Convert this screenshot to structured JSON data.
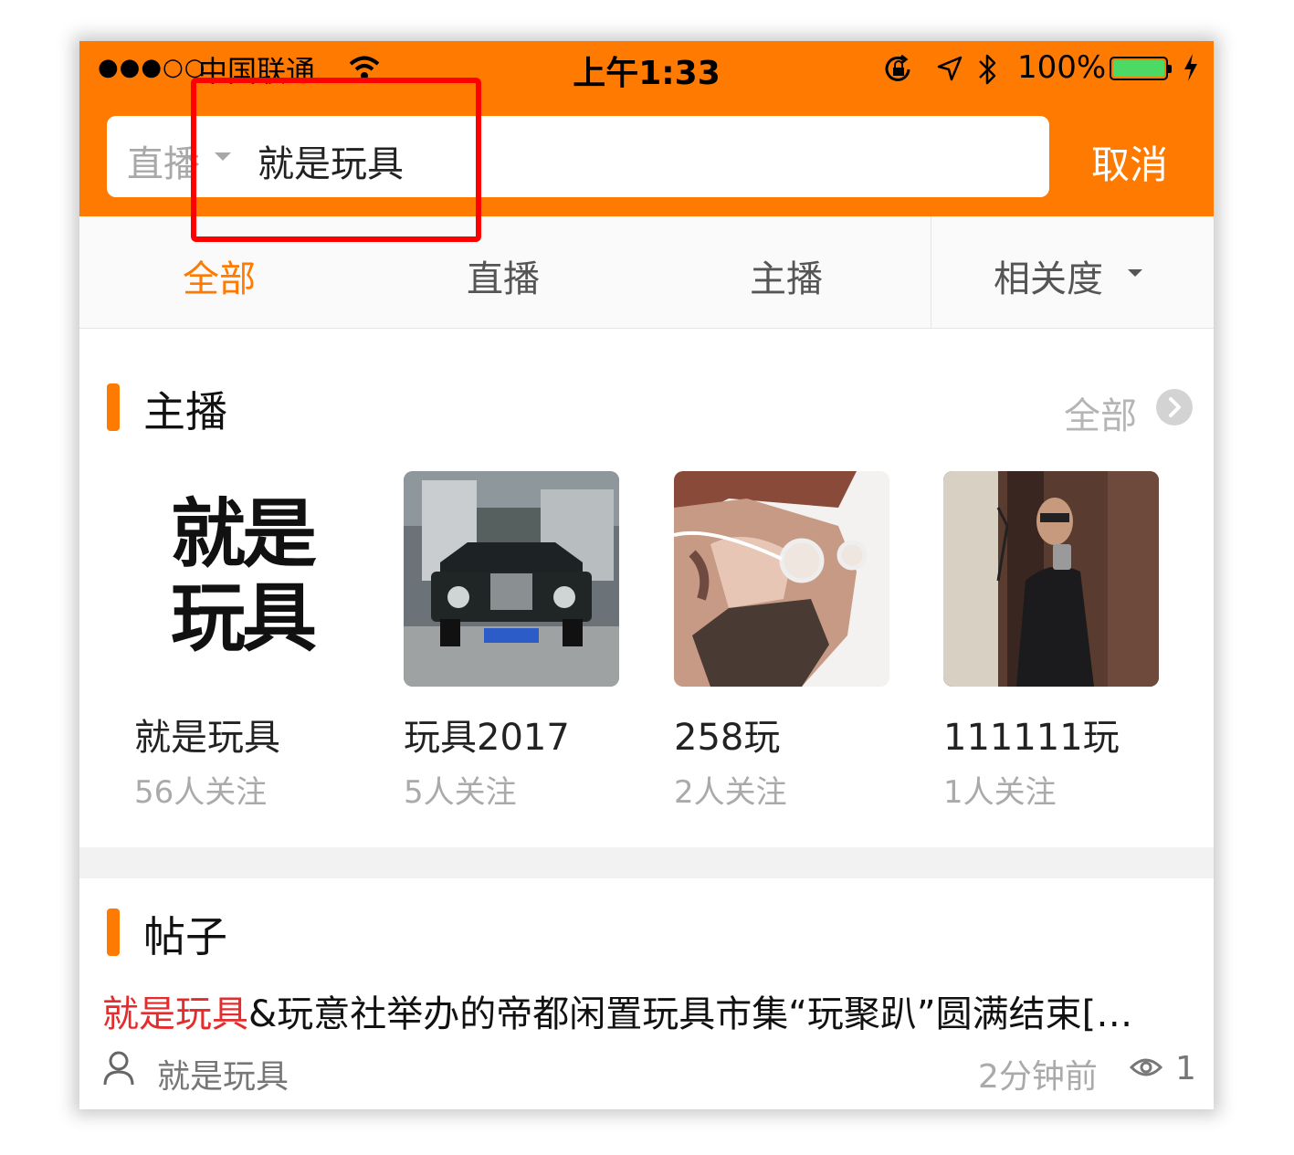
{
  "colors": {
    "accent": "#ff7a00",
    "highlight_red": "#ff0000",
    "keyword_red": "#e52b2b",
    "battery_green": "#4cd964"
  },
  "status_bar": {
    "signal": "●●●○○",
    "carrier": "中国联通",
    "time": "上午1:33",
    "battery_percent": "100%",
    "battery_level": 1.0,
    "icons": [
      "wifi-icon",
      "rotation-lock-icon",
      "location-arrow-icon",
      "bluetooth-icon",
      "battery-icon",
      "charging-bolt-icon"
    ]
  },
  "search": {
    "scope": "直播",
    "query": "就是玩具",
    "cancel_label": "取消"
  },
  "tabs": [
    {
      "label": "全部",
      "active": true
    },
    {
      "label": "直播",
      "active": false
    },
    {
      "label": "主播",
      "active": false
    }
  ],
  "sort": {
    "label": "相关度"
  },
  "anchors_section": {
    "title": "主播",
    "more_label": "全部",
    "items": [
      {
        "name": "就是玩具",
        "followers": "56人关注",
        "avatar_text": "就是玩具",
        "avatar": "logo"
      },
      {
        "name": "玩具2017",
        "followers": "5人关注",
        "avatar": "car-photo"
      },
      {
        "name": "258玩",
        "followers": "2人关注",
        "avatar": "portrait-illustration"
      },
      {
        "name": "111111玩",
        "followers": "1人关注",
        "avatar": "mirror-selfie-photo"
      }
    ]
  },
  "posts_section": {
    "title": "帖子",
    "items": [
      {
        "title_keyword": "就是玩具",
        "title_rest": "&玩意社举办的帝都闲置玩具市集“玩聚趴”圆满结束[…",
        "author": "就是玩具",
        "time": "2分钟前",
        "views": "1"
      }
    ]
  }
}
